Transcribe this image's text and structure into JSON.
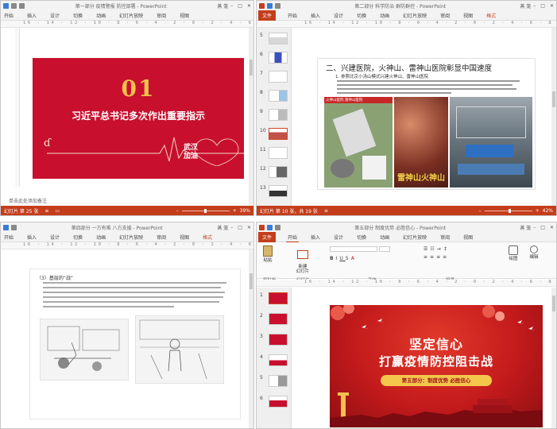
{
  "panes": {
    "tl": {
      "title": "第一部分 疫情警报 防控部署 - PowerPoint",
      "user": "蒸 笼",
      "tabs": [
        "开始",
        "插入",
        "设计",
        "切换",
        "动画",
        "幻灯片放映",
        "审阅",
        "视图"
      ],
      "ruler": "16 · 14 · 12 · 10 · 8 · 6 · 4 · 2 · 0 · 2 · 4 · 6 · 8 · 10 · 12 · 14 · 16",
      "slide": {
        "number": "01",
        "title": "习近平总书记多次作出重要指示",
        "badge_line1": "武汉",
        "badge_line2": "加油"
      },
      "notes": "单击此处添加备注",
      "status_left": "幻灯片 第 25 张",
      "zoom": "39%"
    },
    "tr": {
      "title": "第二部分 科学防治 群防群控 - PowerPoint",
      "user": "蒸 笼",
      "file_tab": "文件",
      "tabs": [
        "开始",
        "插入",
        "设计",
        "切换",
        "动画",
        "幻灯片放映",
        "审阅",
        "视图",
        "格式"
      ],
      "ruler": "16 · 14 · 12 · 10 · 8 · 6 · 4 · 2 · 0 · 2 · 4 · 6 · 8 · 10 · 12 · 14 · 16",
      "thumb_numbers": [
        "5",
        "6",
        "7",
        "8",
        "9",
        "10",
        "11",
        "12",
        "13"
      ],
      "selected_thumb": "10",
      "slide": {
        "heading": "二、兴建医院，火神山、雷神山医院彰显中国速度",
        "subheading": "1. 参照北京小汤山模式兴建火神山、雷神山医院",
        "photo_caption": "火神山医院 雷神山医院",
        "poster_text": "雷神山火神山"
      },
      "status_left": "幻灯片 第 10 张，共 19 张",
      "zoom": "42%"
    },
    "bl": {
      "title": "第四部分 一方有难 八方支援 - PowerPoint",
      "user": "蒸 笼",
      "tabs": [
        "开始",
        "插入",
        "设计",
        "切换",
        "动画",
        "幻灯片放映",
        "审阅",
        "视图",
        "格式"
      ],
      "ruler": "16 · 14 · 12 · 10 · 8 · 6 · 4 · 2 · 0 · 2 · 4 · 6 · 8 · 10 · 12 · 14 · 16",
      "slide": {
        "heading": "（3）基层的“战”"
      }
    },
    "br": {
      "title": "第五部分 制度优势 必胜信心 - PowerPoint",
      "user": "蒸 笼",
      "file_tab": "文件",
      "tabs": [
        "开始",
        "插入",
        "设计",
        "切换",
        "动画",
        "幻灯片放映",
        "审阅",
        "视图"
      ],
      "ribbon_groups": [
        "剪贴板",
        "幻灯片",
        "字体",
        "段落"
      ],
      "ribbon_buttons": {
        "new_slide": "新建\n幻灯片",
        "paste": "粘贴",
        "drawing": "绘图",
        "editing": "编辑"
      },
      "ruler": "16 · 14 · 12 · 10 · 8 · 6 · 4 · 2 · 0 · 2 · 4 · 6 · 8 · 10 · 12 · 14 · 16",
      "thumb_numbers": [
        "1",
        "2",
        "3",
        "4",
        "5",
        "6"
      ],
      "selected_thumb": "1",
      "slide": {
        "title_line1": "坚定信心",
        "title_line2": "打赢疫情防控阻击战",
        "ribbon_text": "第五部分：制度优势 必胜信心"
      }
    }
  },
  "colors": {
    "ppt_orange": "#c43e1c",
    "slide_red": "#c8102e",
    "gold": "#f2c14e"
  }
}
